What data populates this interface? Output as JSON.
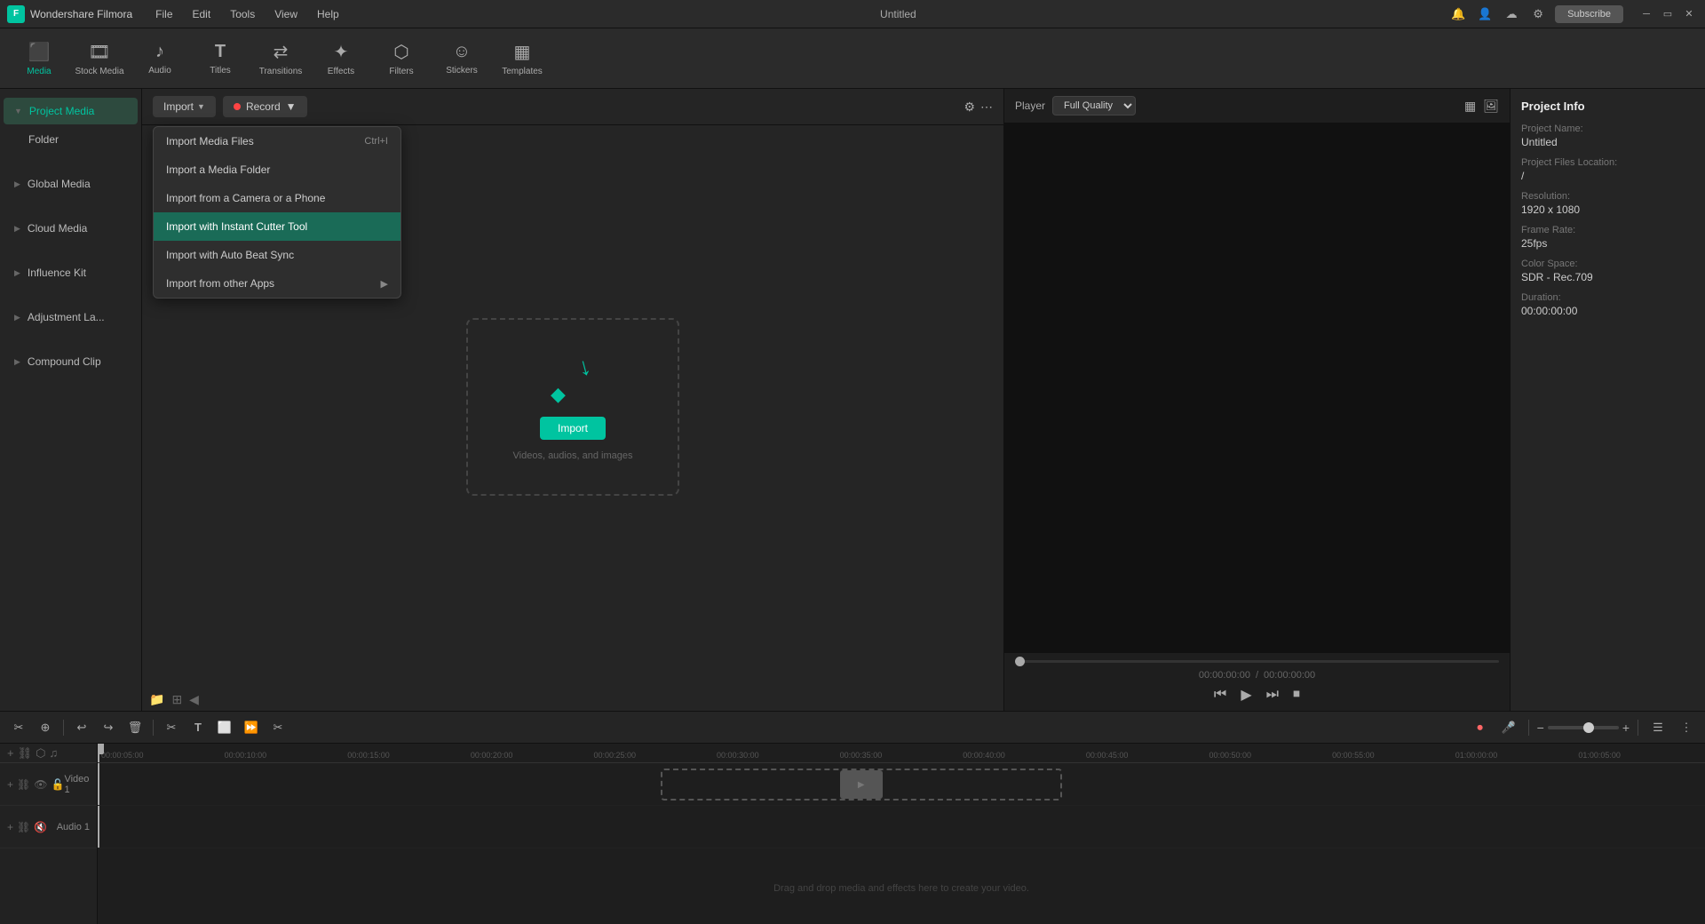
{
  "app": {
    "name": "Wondershare Filmora",
    "title": "Untitled",
    "subscribe_label": "Subscribe"
  },
  "titlebar": {
    "menus": [
      "File",
      "Edit",
      "Tools",
      "View",
      "Help"
    ]
  },
  "toolbar": {
    "items": [
      {
        "id": "media",
        "icon": "⬛",
        "label": "Media",
        "active": true
      },
      {
        "id": "stock",
        "icon": "🎞",
        "label": "Stock Media",
        "active": false
      },
      {
        "id": "audio",
        "icon": "♪",
        "label": "Audio",
        "active": false
      },
      {
        "id": "titles",
        "icon": "T",
        "label": "Titles",
        "active": false
      },
      {
        "id": "transitions",
        "icon": "⇄",
        "label": "Transitions",
        "active": false
      },
      {
        "id": "effects",
        "icon": "✦",
        "label": "Effects",
        "active": false
      },
      {
        "id": "filters",
        "icon": "⬡",
        "label": "Filters",
        "active": false
      },
      {
        "id": "stickers",
        "icon": "☺",
        "label": "Stickers",
        "active": false
      },
      {
        "id": "templates",
        "icon": "▦",
        "label": "Templates",
        "active": false
      }
    ]
  },
  "sidebar": {
    "sections": [
      {
        "items": [
          {
            "id": "project-media",
            "label": "Project Media",
            "active": true
          },
          {
            "id": "folder",
            "label": "Folder",
            "indent": true
          }
        ]
      },
      {
        "items": [
          {
            "id": "global-media",
            "label": "Global Media",
            "active": false
          }
        ]
      },
      {
        "items": [
          {
            "id": "cloud-media",
            "label": "Cloud Media",
            "active": false
          }
        ]
      },
      {
        "items": [
          {
            "id": "influence-kit",
            "label": "Influence Kit",
            "active": false
          }
        ]
      },
      {
        "items": [
          {
            "id": "adjustment-la",
            "label": "Adjustment La...",
            "active": false
          }
        ]
      },
      {
        "items": [
          {
            "id": "compound-clip",
            "label": "Compound Clip",
            "active": false
          }
        ]
      }
    ]
  },
  "media_toolbar": {
    "import_label": "Import",
    "record_label": "Record"
  },
  "dropdown": {
    "items": [
      {
        "id": "import-media-files",
        "label": "Import Media Files",
        "shortcut": "Ctrl+I",
        "highlighted": false
      },
      {
        "id": "import-media-folder",
        "label": "Import a Media Folder",
        "shortcut": "",
        "highlighted": false
      },
      {
        "id": "import-camera-phone",
        "label": "Import from a Camera or a Phone",
        "shortcut": "",
        "highlighted": false
      },
      {
        "id": "import-instant-cutter",
        "label": "Import with Instant Cutter Tool",
        "shortcut": "",
        "highlighted": true
      },
      {
        "id": "import-auto-beat-sync",
        "label": "Import with Auto Beat Sync",
        "shortcut": "",
        "highlighted": false
      },
      {
        "id": "import-other-apps",
        "label": "Import from other Apps",
        "shortcut": "",
        "has_arrow": true,
        "highlighted": false
      }
    ]
  },
  "dropzone": {
    "import_btn_label": "Import",
    "description": "Videos, audios, and images"
  },
  "player": {
    "label": "Player",
    "quality": "Full Quality",
    "time_current": "00:00:00:00",
    "time_total": "00:00:00:00"
  },
  "project_info": {
    "title": "Project Info",
    "fields": [
      {
        "label": "Project Name:",
        "value": "Untitled"
      },
      {
        "label": "Project Files Location:",
        "value": "/"
      },
      {
        "label": "Resolution:",
        "value": "1920 x 1080"
      },
      {
        "label": "Frame Rate:",
        "value": "25fps"
      },
      {
        "label": "Color Space:",
        "value": "SDR - Rec.709"
      },
      {
        "label": "Duration:",
        "value": "00:00:00:00"
      }
    ]
  },
  "timeline": {
    "tracks": [
      {
        "id": "video1",
        "label": "Video 1"
      },
      {
        "id": "audio1",
        "label": "Audio 1"
      }
    ],
    "ticks": [
      "00:00:05:00",
      "00:00:10:00",
      "00:00:15:00",
      "00:00:20:00",
      "00:00:25:00",
      "00:00:30:00",
      "00:00:35:00",
      "00:00:40:00",
      "00:00:45:00",
      "00:00:50:00",
      "00:00:55:00",
      "01:00:00:00",
      "01:00:05:00"
    ],
    "drag_hint": "Drag and drop media and effects here to create your video."
  }
}
